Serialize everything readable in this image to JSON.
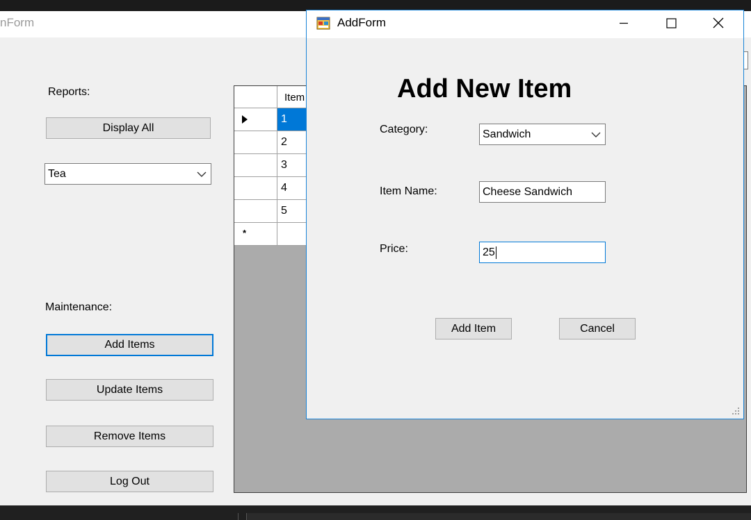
{
  "main_form": {
    "title": "nForm",
    "reports_label": "Reports:",
    "display_all_label": "Display All",
    "category_filter": {
      "selected": "Tea"
    },
    "maintenance_label": "Maintenance:",
    "add_items_label": "Add Items",
    "update_items_label": "Update Items",
    "remove_items_label": "Remove Items",
    "log_out_label": "Log Out",
    "grid": {
      "columns": [
        "Item"
      ],
      "rows": [
        "1",
        "2",
        "3",
        "4",
        "5"
      ],
      "new_row_marker": "*"
    }
  },
  "dialog": {
    "title": "AddForm",
    "heading": "Add New Item",
    "category_label": "Category:",
    "category_value": "Sandwich",
    "item_name_label": "Item Name:",
    "item_name_value": "Cheese Sandwich",
    "price_label": "Price:",
    "price_value": "25",
    "add_item_label": "Add Item",
    "cancel_label": "Cancel"
  },
  "colors": {
    "accent": "#0078d7",
    "form_bg": "#f0f0f0",
    "grid_bg": "#ababab"
  }
}
